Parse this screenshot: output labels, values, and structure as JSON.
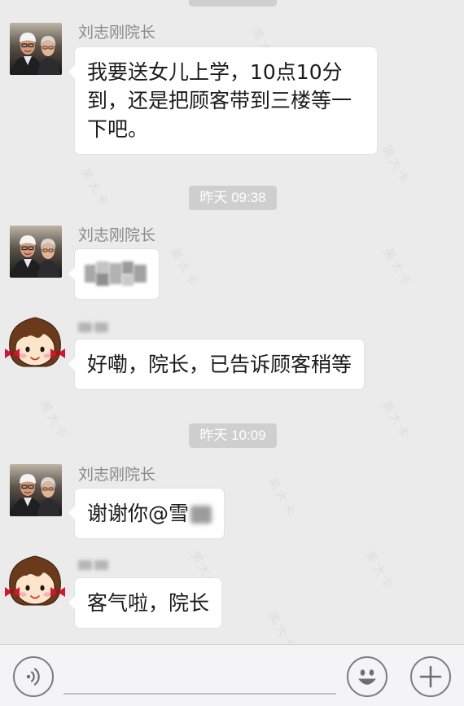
{
  "colors": {
    "background": "#ebebeb",
    "bubble": "#ffffff",
    "timestamp_pill": "#cfcfcf",
    "timestamp_text": "#ffffff",
    "sender_name": "#8a8a8a",
    "message_text": "#1b1b1b",
    "icon_stroke": "#7c7c7c",
    "input_bar": "#f4f4f6"
  },
  "watermark": {
    "text": "美大卡"
  },
  "timestamps": [
    "昨天 09:38",
    "昨天 10:09"
  ],
  "messages": [
    {
      "sender": "刘志刚院长",
      "avatar_icon": "couple-photo-avatar",
      "text": "我要送女儿上学，10点10分到，还是把顾客带到三楼等一下吧。"
    },
    {
      "sender": "刘志刚院长",
      "avatar_icon": "couple-photo-avatar",
      "content_blurred": true
    },
    {
      "sender_blurred": true,
      "avatar_icon": "cartoon-girl-avatar",
      "text": "好嘞，院长，已告诉顾客稍等"
    },
    {
      "sender": "刘志刚院长",
      "avatar_icon": "couple-photo-avatar",
      "text": "谢谢你@雪",
      "mention_partially_blurred": true
    },
    {
      "sender_blurred": true,
      "avatar_icon": "cartoon-girl-avatar",
      "text": "客气啦，院长"
    }
  ],
  "input_bar": {
    "voice_icon": "voice-icon",
    "emoji_icon": "emoji-icon",
    "more_icon": "plus-icon"
  }
}
